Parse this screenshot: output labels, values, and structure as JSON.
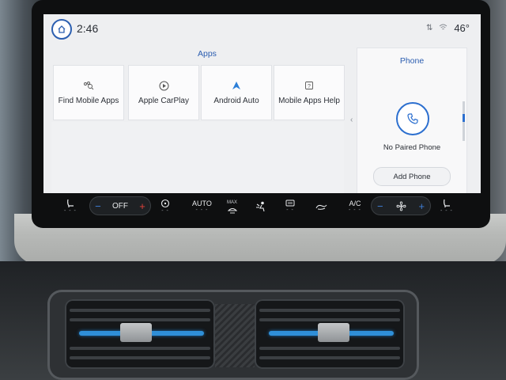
{
  "status": {
    "time": "2:46",
    "temperature": "46°"
  },
  "apps": {
    "title": "Apps",
    "tiles": [
      {
        "label": "Find Mobile Apps",
        "icon": "find-apps-icon"
      },
      {
        "label": "Apple CarPlay",
        "icon": "carplay-icon"
      },
      {
        "label": "Android Auto",
        "icon": "android-auto-icon"
      },
      {
        "label": "Mobile Apps Help",
        "icon": "help-icon"
      }
    ]
  },
  "phone": {
    "title": "Phone",
    "status_text": "No Paired Phone",
    "add_button": "Add Phone"
  },
  "climate": {
    "fan_left_value": "OFF",
    "auto_label": "AUTO",
    "max_label": "MAX",
    "ac_label": "A/C",
    "minus": "−",
    "plus": "+"
  },
  "colors": {
    "accent": "#2c5fb0",
    "temp_up": "#e0413b",
    "vent_blue": "#2f8fd8"
  }
}
